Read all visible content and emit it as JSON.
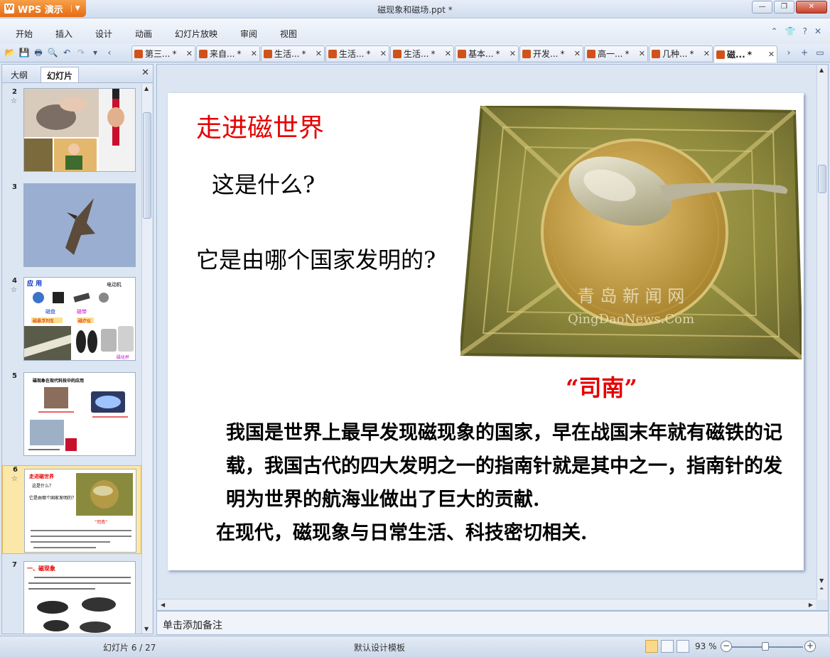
{
  "app": {
    "name": "WPS 演示",
    "doc_title": "磁现象和磁场.ppt *"
  },
  "menu": [
    "开始",
    "插入",
    "设计",
    "动画",
    "幻灯片放映",
    "审阅",
    "视图"
  ],
  "tabs": [
    {
      "label": "第三...",
      "mod": "*",
      "active": false
    },
    {
      "label": "来自...",
      "mod": "*",
      "active": false
    },
    {
      "label": "生活...",
      "mod": "*",
      "active": false
    },
    {
      "label": "生活...",
      "mod": "*",
      "active": false
    },
    {
      "label": "生活...",
      "mod": "*",
      "active": false
    },
    {
      "label": "基本...",
      "mod": "*",
      "active": false
    },
    {
      "label": "开发...",
      "mod": "*",
      "active": false
    },
    {
      "label": "高一...",
      "mod": "*",
      "active": false
    },
    {
      "label": "几种...",
      "mod": "*",
      "active": false
    },
    {
      "label": "磁...",
      "mod": "*",
      "active": true
    }
  ],
  "left_panel": {
    "tab_outline": "大纲",
    "tab_slides": "幻灯片",
    "thumbs": [
      {
        "num": "2"
      },
      {
        "num": "3"
      },
      {
        "num": "4",
        "title": "应 用",
        "labels": [
          "电动机",
          "磁盘",
          "磁带",
          "磁悬浮列车",
          "磁疗仪",
          "磁化杯"
        ]
      },
      {
        "num": "5",
        "title": "磁现象在现代科技中的应用"
      },
      {
        "num": "6",
        "title": "走进磁世界",
        "q1": "这是什么？",
        "q2": "它是由哪个国家发明的？",
        "caption": "“司南”"
      },
      {
        "num": "7",
        "title": "一、磁现象",
        "text": "最初发现的磁体是被称为“天然磁石”的矿物，其中含有四氧化三铁。能吸引其他物体，很像磁铁"
      }
    ]
  },
  "slide": {
    "title": "走进磁世界",
    "q1": "这是什么?",
    "q2": "它是由哪个国家发明的?",
    "caption": "“司南”",
    "watermark1": "青 岛 新 闻 网",
    "watermark2": "QingDaoNews.Com",
    "body1": "我国是世界上最早发现磁现象的国家，早在战国末年就有磁铁的记载，我国古代的四大发明之一的指南针就是其中之一，指南针的发明为世界的航海业做出了巨大的贡献.",
    "body2": "在现代，磁现象与日常生活、科技密切相关."
  },
  "notes": {
    "placeholder": "单击添加备注"
  },
  "status": {
    "slide_counter": "幻灯片 6 / 27",
    "template": "默认设计模板",
    "zoom": "93 %"
  }
}
